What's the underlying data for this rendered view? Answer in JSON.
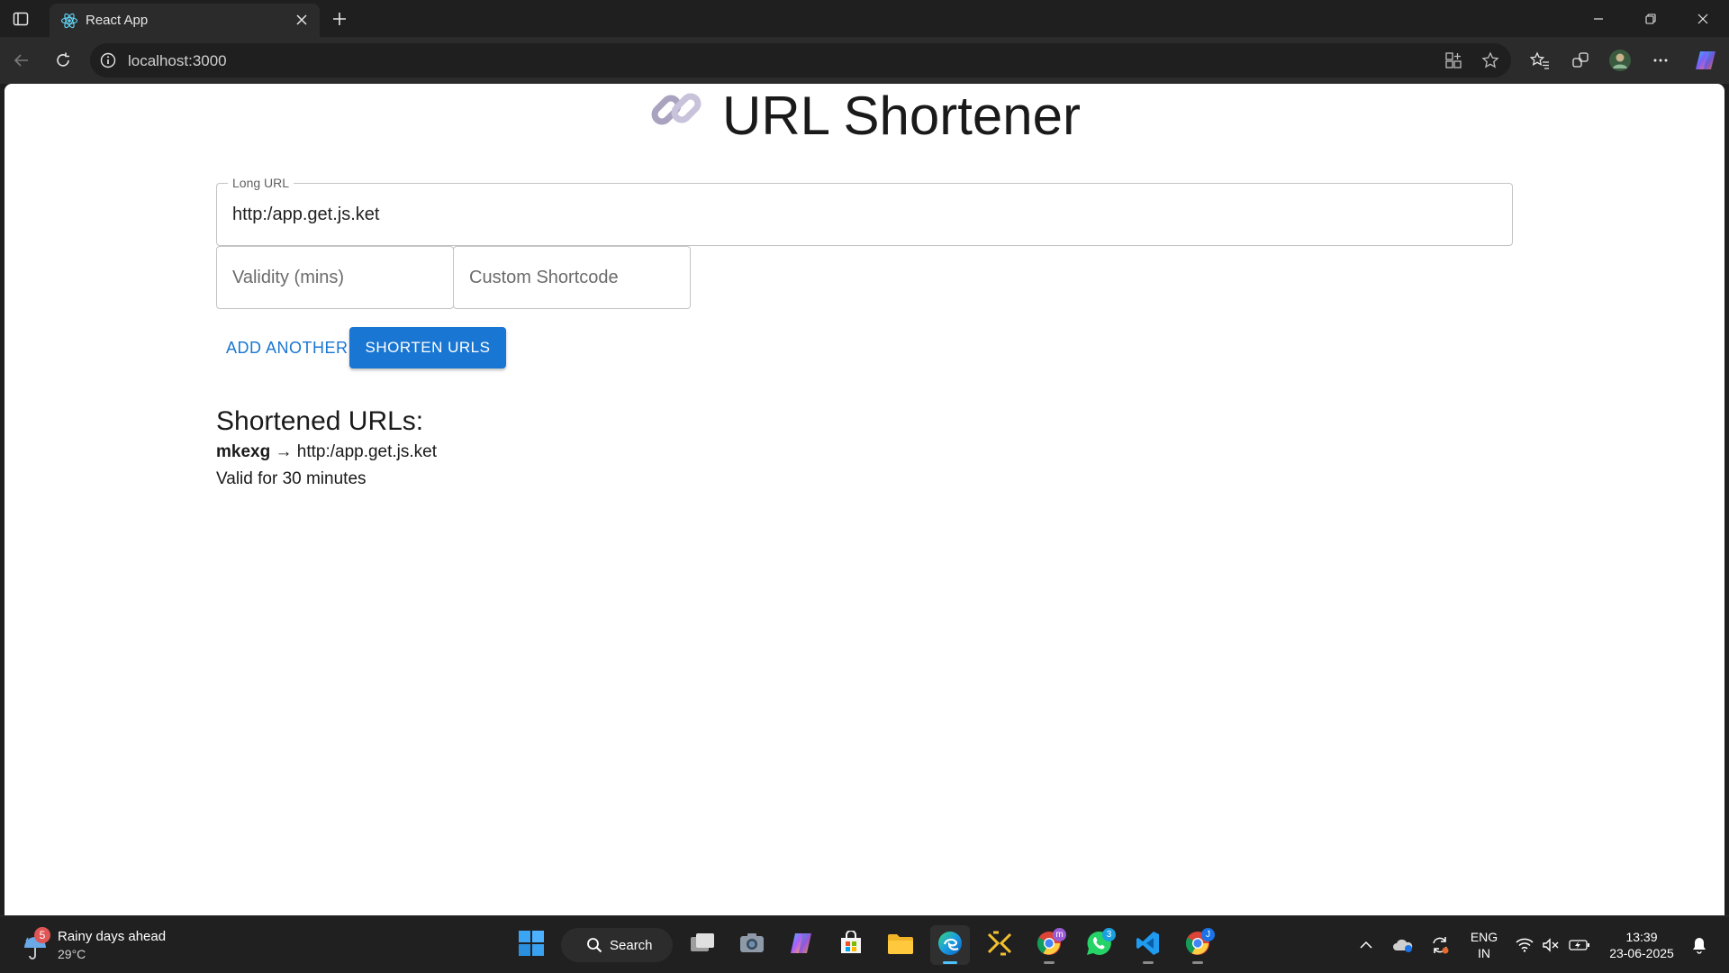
{
  "browser": {
    "tab_title": "React App",
    "url": "localhost:3000"
  },
  "app": {
    "title": "URL Shortener",
    "title_emoji": "🔗",
    "long_url": {
      "label": "Long URL",
      "value": "http:/app.get.js.ket"
    },
    "validity": {
      "placeholder": "Validity (mins)",
      "value": ""
    },
    "shortcode": {
      "placeholder": "Custom Shortcode",
      "value": ""
    },
    "add_another_label": "ADD ANOTHER",
    "shorten_label": "SHORTEN URLS",
    "results": {
      "heading": "Shortened URLs:",
      "items": [
        {
          "code": "mkexg",
          "arrow": "→",
          "url": "http:/app.get.js.ket",
          "validity_text": "Valid for 30 minutes"
        }
      ]
    }
  },
  "taskbar": {
    "weather": {
      "text": "Rainy days ahead",
      "temp": "29°C",
      "badge": "5"
    },
    "search_label": "Search",
    "apps": [
      {
        "name": "start",
        "icon": "windows-icon"
      },
      {
        "name": "task-view",
        "icon": "task-view-icon"
      },
      {
        "name": "camera",
        "icon": "camera-icon"
      },
      {
        "name": "copilot",
        "icon": "copilot-icon"
      },
      {
        "name": "store",
        "icon": "store-icon"
      },
      {
        "name": "file-explorer",
        "icon": "folder-icon"
      },
      {
        "name": "edge",
        "icon": "edge-icon"
      },
      {
        "name": "app-yellow",
        "icon": "app-yellow-icon"
      },
      {
        "name": "chrome-m",
        "icon": "chrome-icon",
        "badge": "m"
      },
      {
        "name": "whatsapp",
        "icon": "whatsapp-icon",
        "badge": "3"
      },
      {
        "name": "vscode",
        "icon": "vscode-icon"
      },
      {
        "name": "chrome-j",
        "icon": "chrome-icon",
        "badge": "J"
      }
    ],
    "language": "ENG",
    "region": "IN",
    "time": "13:39",
    "date": "23-06-2025"
  },
  "colors": {
    "primary": "#1976d2",
    "tab_active": "#2b2b2b",
    "chrome_bg": "#1f1f1f",
    "edge_indicator": "#4cc2ff"
  }
}
